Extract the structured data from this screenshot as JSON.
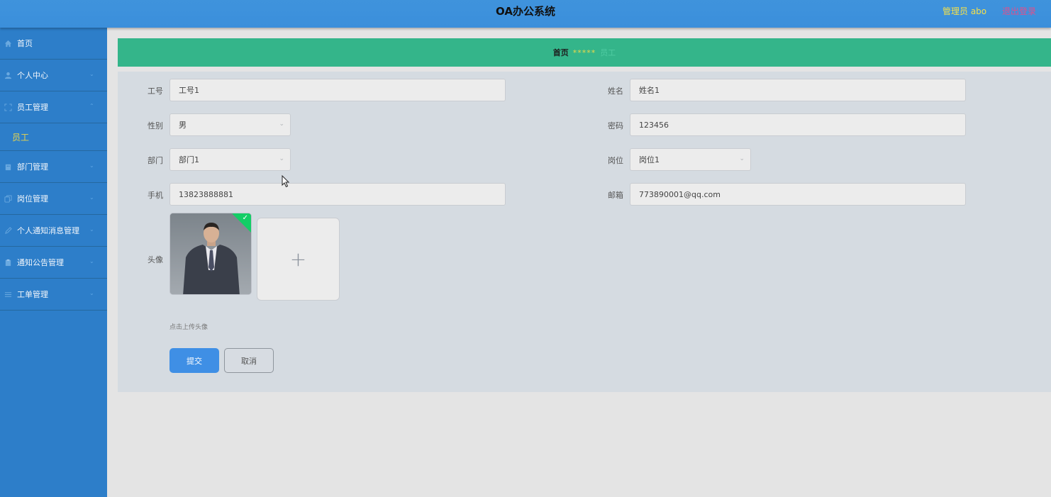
{
  "header": {
    "title": "OA办公系统",
    "user": "管理员 abo",
    "logout": "退出登录"
  },
  "sidebar": {
    "items": [
      {
        "label": "首页",
        "icon": "home-icon"
      },
      {
        "label": "个人中心",
        "icon": "user-icon"
      },
      {
        "label": "员工管理",
        "icon": "fullscreen-icon",
        "expanded": true,
        "sub": "员工"
      },
      {
        "label": "部门管理",
        "icon": "building-icon"
      },
      {
        "label": "岗位管理",
        "icon": "copy-icon"
      },
      {
        "label": "个人通知消息管理",
        "icon": "edit-icon"
      },
      {
        "label": "通知公告管理",
        "icon": "clipboard-icon"
      },
      {
        "label": "工单管理",
        "icon": "list-icon"
      }
    ]
  },
  "breadcrumb": {
    "home": "首页",
    "sep": "*****",
    "current": "员工"
  },
  "form": {
    "emp_no": {
      "label": "工号",
      "value": "工号1"
    },
    "name": {
      "label": "姓名",
      "value": "姓名1"
    },
    "gender": {
      "label": "性别",
      "value": "男"
    },
    "password": {
      "label": "密码",
      "value": "123456"
    },
    "dept": {
      "label": "部门",
      "value": "部门1"
    },
    "post": {
      "label": "岗位",
      "value": "岗位1"
    },
    "phone": {
      "label": "手机",
      "value": "13823888881"
    },
    "email": {
      "label": "邮箱",
      "value": "773890001@qq.com"
    },
    "avatar": {
      "label": "头像",
      "tip": "点击上传头像",
      "upload": "+"
    }
  },
  "buttons": {
    "submit": "提交",
    "cancel": "取消"
  },
  "colors": {
    "header": "#3f93dc",
    "sidebar": "#2d7ec9",
    "breadcrumb": "#34b58a",
    "primary": "#3f8fe5",
    "highlight": "#e8d44d"
  }
}
